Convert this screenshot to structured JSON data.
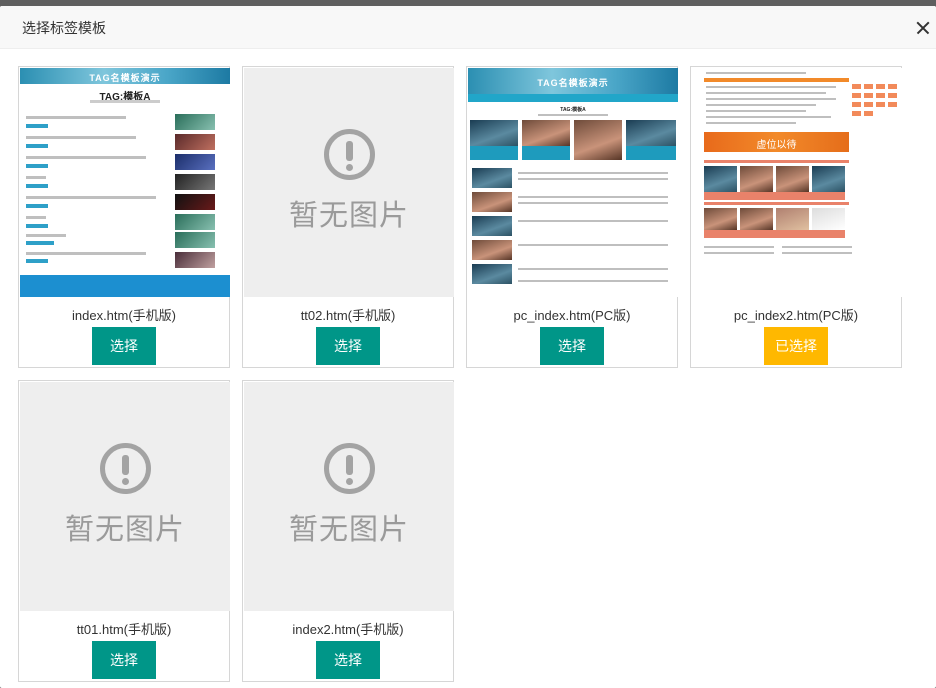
{
  "dialog": {
    "title": "选择标签模板",
    "close_icon": "close-icon"
  },
  "placeholder_text": "暂无图片",
  "templates": [
    {
      "name": "index.htm(手机版)",
      "button": "选择",
      "selected": false,
      "has_preview": true,
      "preview_title": "TAG:模板A",
      "banner_text": "TAG名模板演示"
    },
    {
      "name": "tt02.htm(手机版)",
      "button": "选择",
      "selected": false,
      "has_preview": false
    },
    {
      "name": "pc_index.htm(PC版)",
      "button": "选择",
      "selected": false,
      "has_preview": true,
      "preview_title": "TAG:模板A",
      "banner_text": "TAG名模板演示"
    },
    {
      "name": "pc_index2.htm(PC版)",
      "button": "已选择",
      "selected": true,
      "has_preview": true,
      "banner_text": "虚位以待"
    },
    {
      "name": "tt01.htm(手机版)",
      "button": "选择",
      "selected": false,
      "has_preview": false
    },
    {
      "name": "index2.htm(手机版)",
      "button": "选择",
      "selected": false,
      "has_preview": false
    }
  ],
  "colors": {
    "select_button": "#009688",
    "selected_button": "#ffb800",
    "placeholder_bg": "#eeeeee"
  }
}
